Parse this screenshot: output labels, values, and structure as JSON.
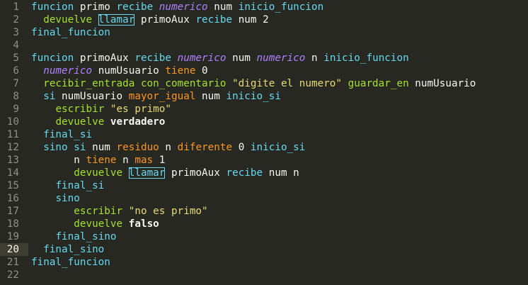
{
  "editor": {
    "active_line": 20,
    "colors": {
      "background": "#272822",
      "keyword": "#66d9ef",
      "function": "#a6e22e",
      "type": "#ae81ff",
      "operator": "#fd971f",
      "string": "#e6db74",
      "text": "#f8f8f2",
      "line_number": "#8f908a"
    },
    "lines": [
      {
        "n": "1",
        "tokens": [
          {
            "c": "kw",
            "t": "funcion"
          },
          {
            "c": "plain",
            "t": " primo "
          },
          {
            "c": "kw",
            "t": "recibe"
          },
          {
            "c": "plain",
            "t": " "
          },
          {
            "c": "ty",
            "t": "numerico"
          },
          {
            "c": "plain",
            "t": " num "
          },
          {
            "c": "kw",
            "t": "inicio_funcion"
          }
        ]
      },
      {
        "n": "2",
        "tokens": [
          {
            "c": "plain",
            "t": "  "
          },
          {
            "c": "fn",
            "t": "devuelve"
          },
          {
            "c": "plain",
            "t": " "
          },
          {
            "c": "bx",
            "t": "llamar"
          },
          {
            "c": "plain",
            "t": " primoAux "
          },
          {
            "c": "kw",
            "t": "recibe"
          },
          {
            "c": "plain",
            "t": " num 2"
          }
        ]
      },
      {
        "n": "3",
        "tokens": [
          {
            "c": "kw",
            "t": "final_funcion"
          }
        ]
      },
      {
        "n": "4",
        "tokens": []
      },
      {
        "n": "5",
        "tokens": [
          {
            "c": "kw",
            "t": "funcion"
          },
          {
            "c": "plain",
            "t": " primoAux "
          },
          {
            "c": "kw",
            "t": "recibe"
          },
          {
            "c": "plain",
            "t": " "
          },
          {
            "c": "ty",
            "t": "numerico"
          },
          {
            "c": "plain",
            "t": " num "
          },
          {
            "c": "ty",
            "t": "numerico"
          },
          {
            "c": "plain",
            "t": " n "
          },
          {
            "c": "kw",
            "t": "inicio_funcion"
          }
        ]
      },
      {
        "n": "6",
        "tokens": [
          {
            "c": "plain",
            "t": "  "
          },
          {
            "c": "ty",
            "t": "numerico"
          },
          {
            "c": "plain",
            "t": " numUsuario "
          },
          {
            "c": "op",
            "t": "tiene"
          },
          {
            "c": "plain",
            "t": " 0"
          }
        ]
      },
      {
        "n": "7",
        "tokens": [
          {
            "c": "plain",
            "t": "  "
          },
          {
            "c": "fn",
            "t": "recibir_entrada"
          },
          {
            "c": "plain",
            "t": " "
          },
          {
            "c": "fn",
            "t": "con_comentario"
          },
          {
            "c": "plain",
            "t": " "
          },
          {
            "c": "st",
            "t": "\"digite el numero\""
          },
          {
            "c": "plain",
            "t": " "
          },
          {
            "c": "fn",
            "t": "guardar_en"
          },
          {
            "c": "plain",
            "t": " numUsuario"
          }
        ]
      },
      {
        "n": "8",
        "tokens": [
          {
            "c": "plain",
            "t": "  "
          },
          {
            "c": "kw",
            "t": "si"
          },
          {
            "c": "plain",
            "t": " numUsuario "
          },
          {
            "c": "op",
            "t": "mayor_igual"
          },
          {
            "c": "plain",
            "t": " num "
          },
          {
            "c": "kw",
            "t": "inicio_si"
          }
        ]
      },
      {
        "n": "9",
        "tokens": [
          {
            "c": "plain",
            "t": "    "
          },
          {
            "c": "fn",
            "t": "escribir"
          },
          {
            "c": "plain",
            "t": " "
          },
          {
            "c": "st",
            "t": "\"es primo\""
          }
        ]
      },
      {
        "n": "10",
        "tokens": [
          {
            "c": "plain",
            "t": "    "
          },
          {
            "c": "fn",
            "t": "devuelve"
          },
          {
            "c": "plain",
            "t": " "
          },
          {
            "c": "bd",
            "t": "verdadero"
          }
        ]
      },
      {
        "n": "11",
        "tokens": [
          {
            "c": "plain",
            "t": "  "
          },
          {
            "c": "kw",
            "t": "final_si"
          }
        ]
      },
      {
        "n": "12",
        "tokens": [
          {
            "c": "plain",
            "t": "  "
          },
          {
            "c": "kw",
            "t": "sino si"
          },
          {
            "c": "plain",
            "t": " num "
          },
          {
            "c": "op",
            "t": "residuo"
          },
          {
            "c": "plain",
            "t": " n "
          },
          {
            "c": "op",
            "t": "diferente"
          },
          {
            "c": "plain",
            "t": " 0 "
          },
          {
            "c": "kw",
            "t": "inicio_si"
          }
        ]
      },
      {
        "n": "13",
        "tokens": [
          {
            "c": "plain",
            "t": "       n "
          },
          {
            "c": "op",
            "t": "tiene"
          },
          {
            "c": "plain",
            "t": " n "
          },
          {
            "c": "op",
            "t": "mas"
          },
          {
            "c": "plain",
            "t": " 1"
          }
        ]
      },
      {
        "n": "14",
        "tokens": [
          {
            "c": "plain",
            "t": "       "
          },
          {
            "c": "fn",
            "t": "devuelve"
          },
          {
            "c": "plain",
            "t": " "
          },
          {
            "c": "bx",
            "t": "llamar"
          },
          {
            "c": "plain",
            "t": " primoAux "
          },
          {
            "c": "kw",
            "t": "recibe"
          },
          {
            "c": "plain",
            "t": " num n"
          }
        ]
      },
      {
        "n": "15",
        "tokens": [
          {
            "c": "plain",
            "t": "    "
          },
          {
            "c": "kw",
            "t": "final_si"
          }
        ]
      },
      {
        "n": "16",
        "tokens": [
          {
            "c": "plain",
            "t": "    "
          },
          {
            "c": "kw",
            "t": "sino"
          }
        ]
      },
      {
        "n": "17",
        "tokens": [
          {
            "c": "plain",
            "t": "       "
          },
          {
            "c": "fn",
            "t": "escribir"
          },
          {
            "c": "plain",
            "t": " "
          },
          {
            "c": "st",
            "t": "\"no es primo\""
          }
        ]
      },
      {
        "n": "18",
        "tokens": [
          {
            "c": "plain",
            "t": "       "
          },
          {
            "c": "fn",
            "t": "devuelve"
          },
          {
            "c": "plain",
            "t": " "
          },
          {
            "c": "bd",
            "t": "falso"
          }
        ]
      },
      {
        "n": "19",
        "tokens": [
          {
            "c": "plain",
            "t": "    "
          },
          {
            "c": "kw",
            "t": "final_sino"
          }
        ]
      },
      {
        "n": "20",
        "tokens": [
          {
            "c": "plain",
            "t": "  "
          },
          {
            "c": "kw",
            "t": "final_sino"
          }
        ]
      },
      {
        "n": "21",
        "tokens": [
          {
            "c": "kw",
            "t": "final_funcion"
          }
        ]
      },
      {
        "n": "22",
        "tokens": []
      }
    ]
  }
}
